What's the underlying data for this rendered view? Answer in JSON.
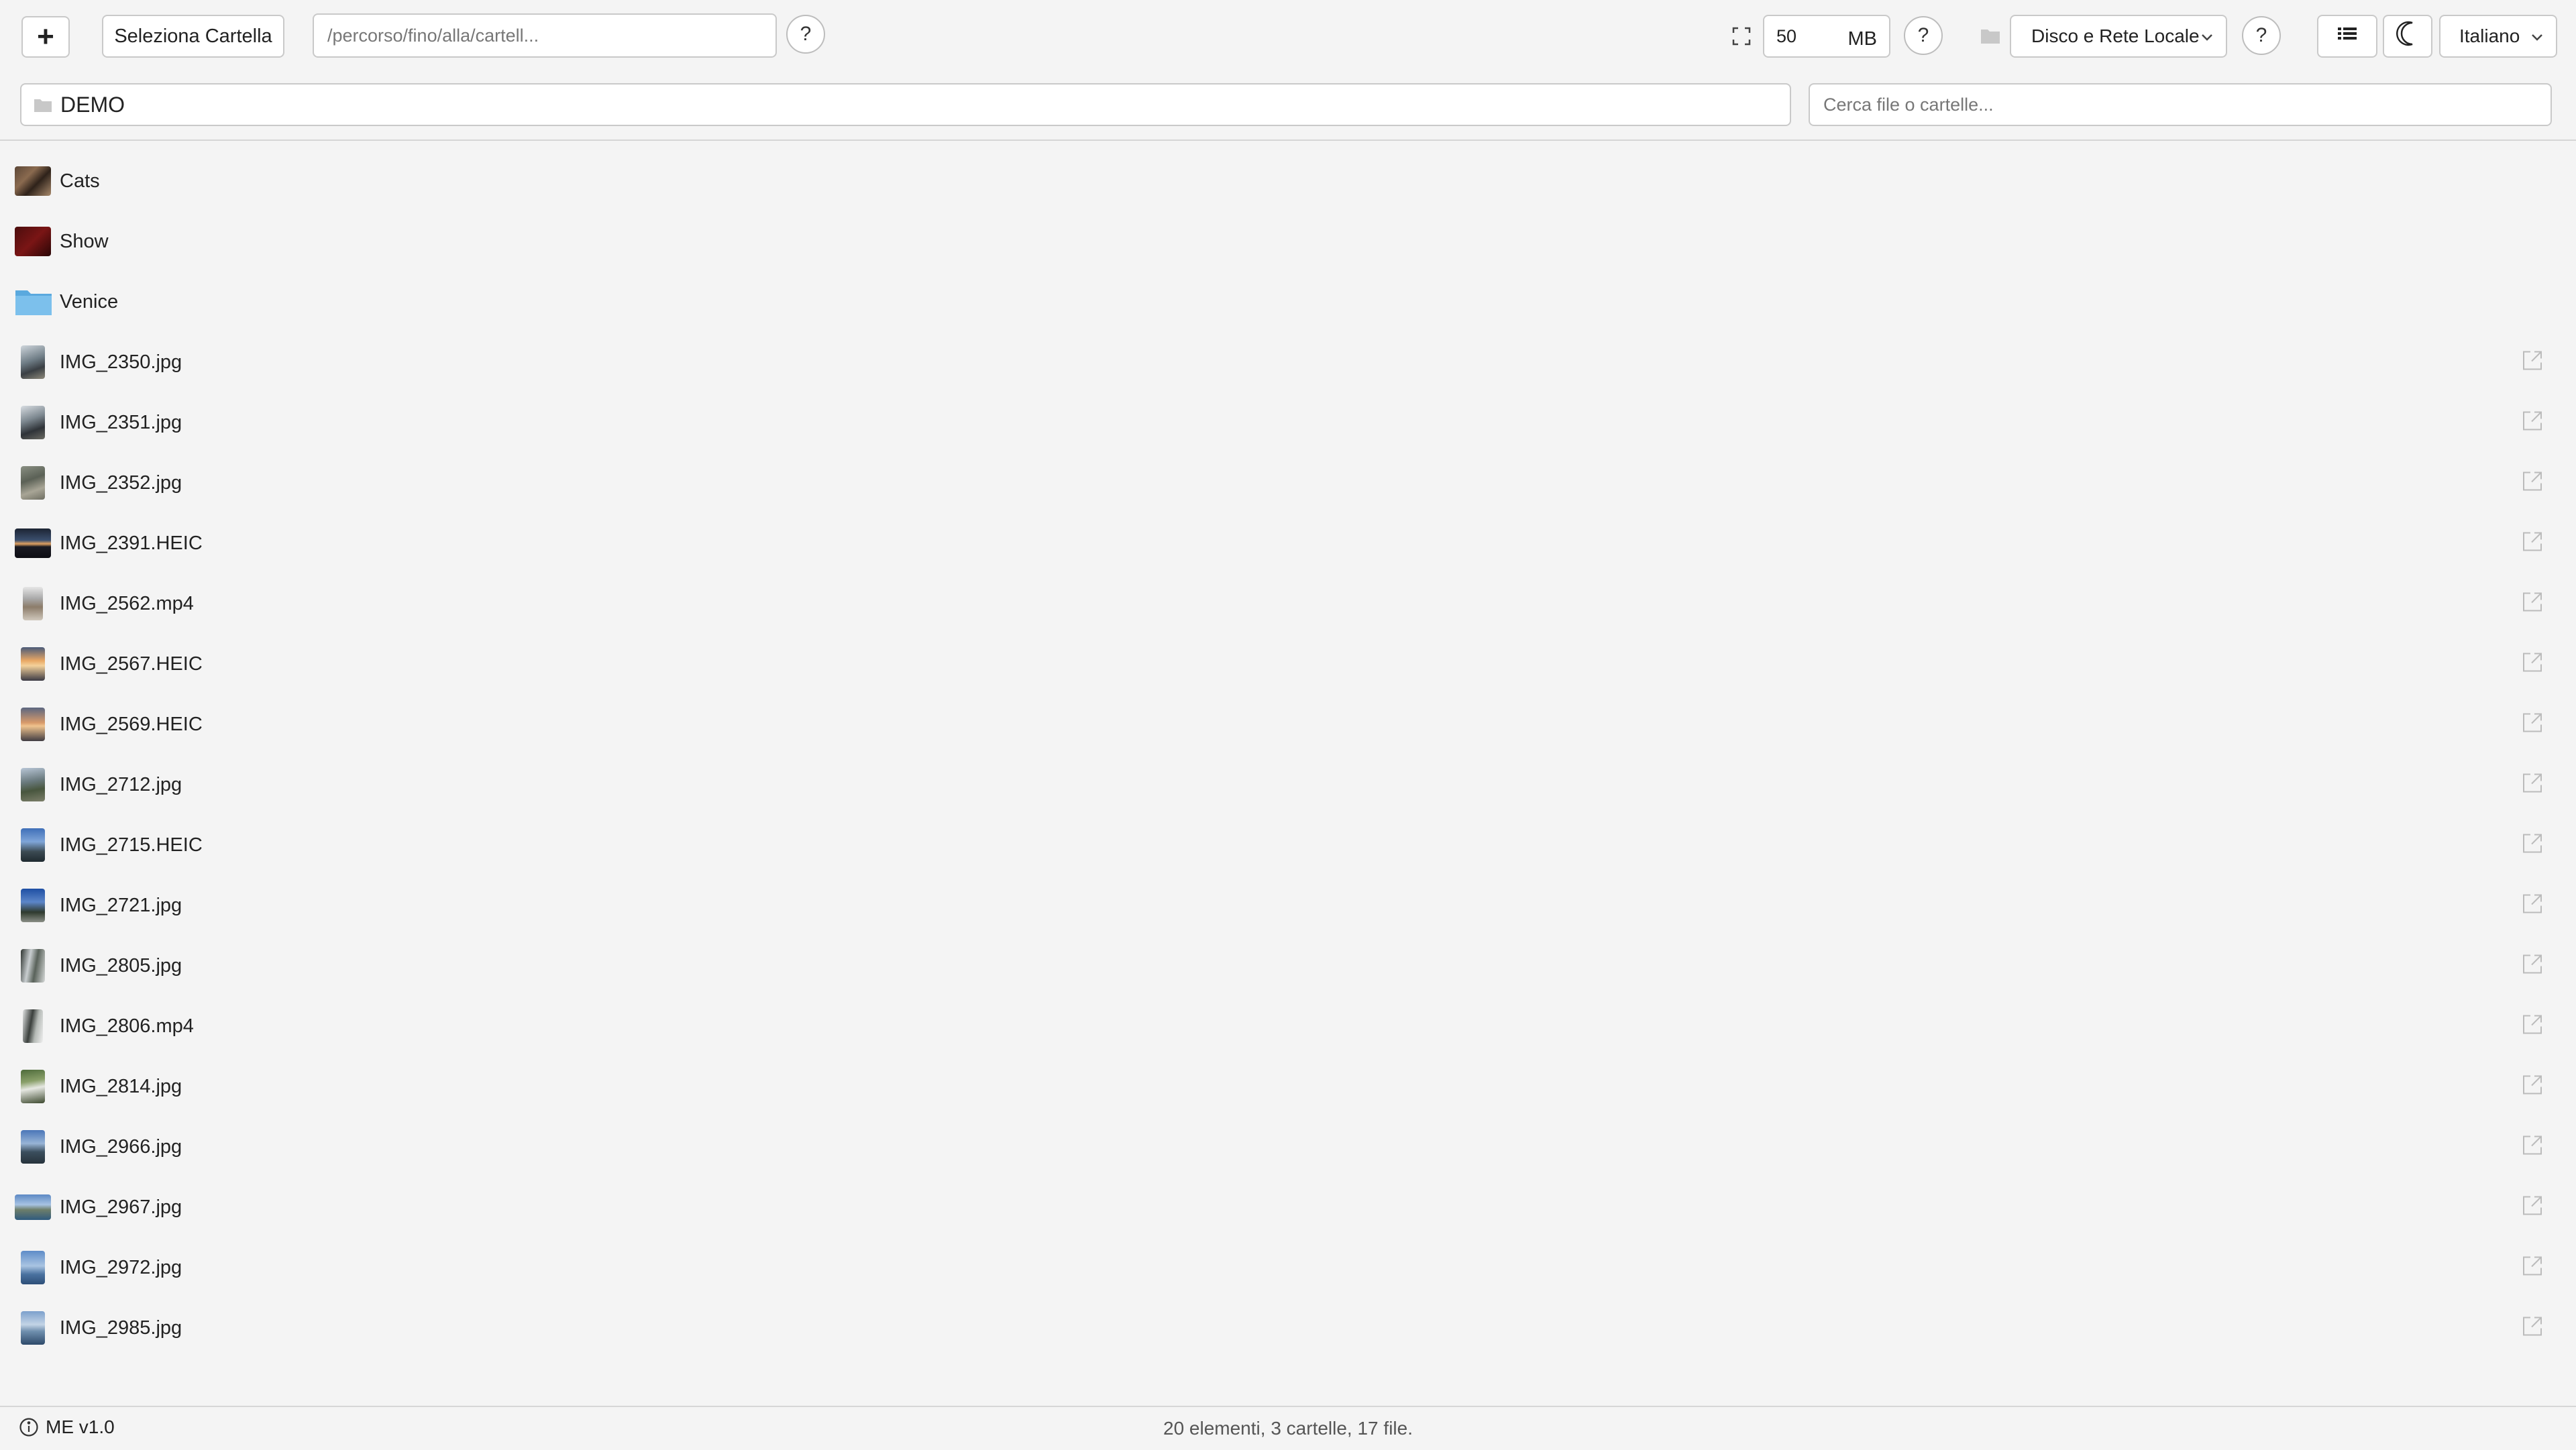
{
  "toolbar": {
    "add_label": "+",
    "select_folder_label": "Seleziona Cartella",
    "path_placeholder": "/percorso/fino/alla/cartell...",
    "help_label": "?",
    "size_value": "50",
    "size_unit": "MB",
    "source_selected": "Disco e Rete Locale",
    "language_selected": "Italiano"
  },
  "location": {
    "current_folder": "DEMO",
    "search_placeholder": "Cerca file o cartelle..."
  },
  "items": [
    {
      "name": "Cats",
      "kind": "folder"
    },
    {
      "name": "Show",
      "kind": "folder"
    },
    {
      "name": "Venice",
      "kind": "folder"
    },
    {
      "name": "IMG_2350.jpg",
      "kind": "file"
    },
    {
      "name": "IMG_2351.jpg",
      "kind": "file"
    },
    {
      "name": "IMG_2352.jpg",
      "kind": "file"
    },
    {
      "name": "IMG_2391.HEIC",
      "kind": "file"
    },
    {
      "name": "IMG_2562.mp4",
      "kind": "file"
    },
    {
      "name": "IMG_2567.HEIC",
      "kind": "file"
    },
    {
      "name": "IMG_2569.HEIC",
      "kind": "file"
    },
    {
      "name": "IMG_2712.jpg",
      "kind": "file"
    },
    {
      "name": "IMG_2715.HEIC",
      "kind": "file"
    },
    {
      "name": "IMG_2721.jpg",
      "kind": "file"
    },
    {
      "name": "IMG_2805.jpg",
      "kind": "file"
    },
    {
      "name": "IMG_2806.mp4",
      "kind": "file"
    },
    {
      "name": "IMG_2814.jpg",
      "kind": "file"
    },
    {
      "name": "IMG_2966.jpg",
      "kind": "file"
    },
    {
      "name": "IMG_2967.jpg",
      "kind": "file"
    },
    {
      "name": "IMG_2972.jpg",
      "kind": "file"
    },
    {
      "name": "IMG_2985.jpg",
      "kind": "file"
    }
  ],
  "footer": {
    "version": "ME v1.0",
    "summary": "20 elementi, 3 cartelle, 17 file."
  },
  "icons": {
    "add": "plus-icon",
    "help": "question-icon",
    "fit": "fit-screen-icon",
    "source": "folder-icon",
    "view": "list-view-icon",
    "theme": "moon-icon",
    "open": "open-external-icon",
    "info": "info-icon"
  },
  "colors": {
    "background": "#f4f4f4",
    "border": "#c9c9c9",
    "text": "#222222",
    "folder_blue": "#5aa9de"
  }
}
